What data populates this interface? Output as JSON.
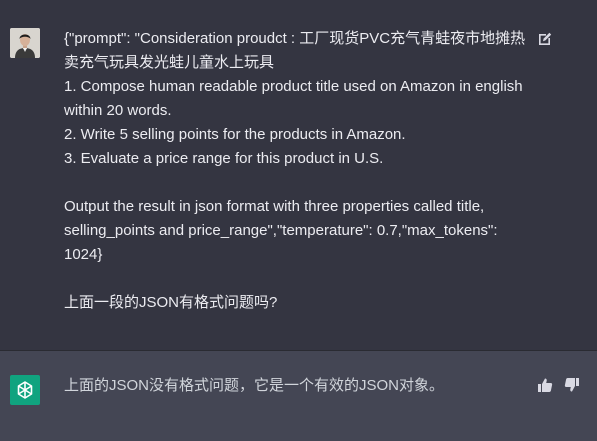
{
  "conversation": {
    "user_message": {
      "text": "{\"prompt\": \"Consideration proudct : 工厂现货PVC充气青蛙夜市地摊热卖充气玩具发光蛙儿童水上玩具\n1. Compose human readable product title used on Amazon in english within 20 words.\n2. Write 5 selling points for the products in Amazon.\n3. Evaluate a price range for this product in U.S.\n\nOutput the result in json format with three properties called title, selling_points and price_range\",\"temperature\": 0.7,\"max_tokens\": 1024}\n\n上面一段的JSON有格式问题吗?",
      "avatar_icon": "user-photo-avatar",
      "edit_icon": "edit-pencil-icon"
    },
    "assistant_message": {
      "text": "上面的JSON没有格式问题，它是一个有效的JSON对象。",
      "avatar_icon": "chatgpt-logo-icon",
      "thumbs_up_icon": "thumbs-up-icon",
      "thumbs_down_icon": "thumbs-down-icon"
    }
  },
  "colors": {
    "background": "#343541",
    "assistant_background": "#444654",
    "text": "#ececf1",
    "brand": "#10a37f",
    "icon": "#d9d9e3"
  }
}
